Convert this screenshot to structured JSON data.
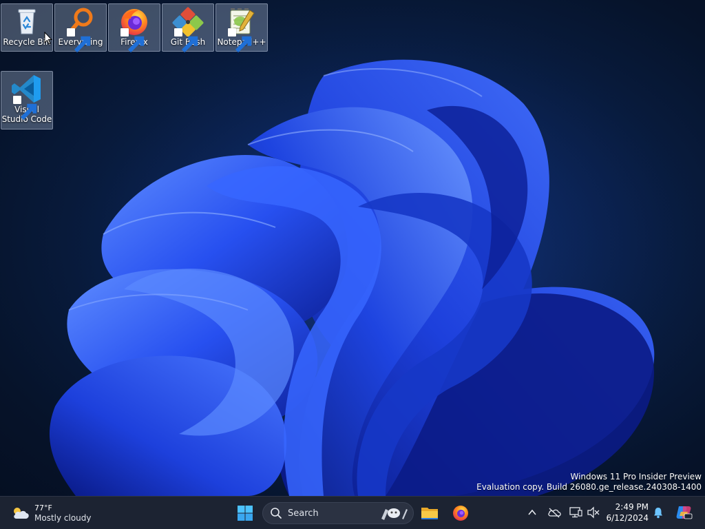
{
  "desktop": {
    "icons": [
      {
        "label": "Recycle Bin",
        "icon": "recycle-bin-icon",
        "shortcut": false
      },
      {
        "label": "Everything",
        "icon": "everything-search-icon",
        "shortcut": true
      },
      {
        "label": "Firefox",
        "icon": "firefox-icon",
        "shortcut": true
      },
      {
        "label": "Git Bash",
        "icon": "git-bash-icon",
        "shortcut": true
      },
      {
        "label": "Notepad++",
        "icon": "notepad-plus-plus-icon",
        "shortcut": true
      },
      {
        "label": "Visual Studio Code",
        "icon": "vscode-icon",
        "shortcut": true
      }
    ],
    "watermark": {
      "line1": "Windows 11 Pro Insider Preview",
      "line2": "Evaluation copy. Build 26080.ge_release.240308-1400"
    }
  },
  "taskbar": {
    "weather": {
      "temp": "77°F",
      "condition": "Mostly cloudy",
      "icon": "cloud-sun-icon"
    },
    "start_icon": "windows-start-icon",
    "search": {
      "label": "Search"
    },
    "pinned": [
      {
        "name": "file-explorer",
        "icon": "folder-icon"
      },
      {
        "name": "firefox",
        "icon": "firefox-icon"
      }
    ],
    "tray": {
      "icons": [
        "chevron-up-icon",
        "onedrive-icon",
        "network-icon",
        "volume-muted-icon"
      ],
      "time": "2:49 PM",
      "date": "6/12/2024",
      "notification_icon": "bell-icon",
      "copilot_icon": "copilot-icon"
    }
  },
  "colors": {
    "taskbar_bg": "#1c2332",
    "bloom_light": "#4b7bff",
    "bloom_mid": "#1f47e6",
    "bloom_dark": "#0a1d8c",
    "desktop_bg": "#081b3d"
  }
}
